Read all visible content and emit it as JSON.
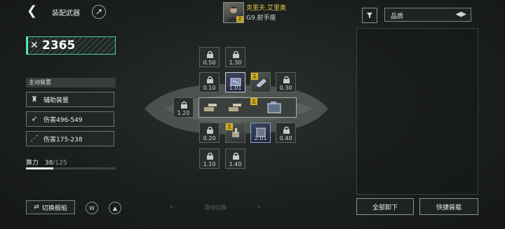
{
  "header": {
    "title": "装配武器",
    "pilot_name": "克里夫.艾里奥",
    "pilot_rank": "G9.射手座",
    "pilot_level": "2",
    "sort_label": "品质"
  },
  "power": {
    "value": "2365"
  },
  "equipment": {
    "section_label": "主动装置",
    "items": [
      {
        "label": "辅助装置",
        "icon": "turret-icon"
      },
      {
        "label": "伤害496-549",
        "icon": "missile-icon"
      },
      {
        "label": "伤害175-238",
        "icon": "scatter-icon"
      }
    ]
  },
  "compute": {
    "label": "算力",
    "used": "38",
    "total": "/125",
    "fraction": 0.304
  },
  "grid": {
    "main_badge": "主",
    "slots": [
      {
        "id": "r0c1",
        "value": "0.50",
        "state": "locked"
      },
      {
        "id": "r0c2",
        "value": "1.30",
        "state": "locked"
      },
      {
        "id": "r1c1",
        "value": "0.10",
        "state": "locked"
      },
      {
        "id": "r1c2",
        "value": "1.01",
        "state": "equipped"
      },
      {
        "id": "r1c3",
        "value": "",
        "state": "equipped-main"
      },
      {
        "id": "r1c4",
        "value": "0.30",
        "state": "locked"
      },
      {
        "id": "r2c0",
        "value": "1.20",
        "state": "locked"
      },
      {
        "id": "r3c1",
        "value": "0.20",
        "state": "locked"
      },
      {
        "id": "r3c2",
        "value": "",
        "state": "equipped-main"
      },
      {
        "id": "r3c3",
        "value": "2.01",
        "state": "equipped"
      },
      {
        "id": "r3c4",
        "value": "0.40",
        "state": "locked"
      },
      {
        "id": "r4c1",
        "value": "1.10",
        "state": "locked"
      },
      {
        "id": "r4c2",
        "value": "1.40",
        "state": "locked"
      }
    ]
  },
  "footer": {
    "switch_ship": "切换舰船",
    "slide_switch": "滑动切换",
    "unload_all": "全部卸下",
    "quick_equip": "快捷装载"
  },
  "colors": {
    "accent_green": "#47d49a",
    "main_badge": "#d6b51c",
    "pilot_name": "#e5c94b"
  }
}
